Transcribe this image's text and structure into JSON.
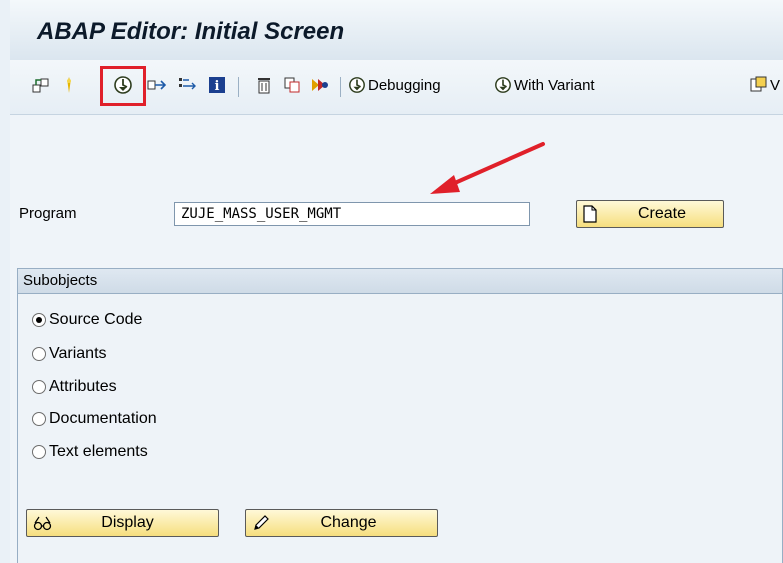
{
  "screen": {
    "title": "ABAP Editor: Initial Screen"
  },
  "toolbar": {
    "icons": [
      "other-object-icon",
      "activate-icon",
      "execute-icon",
      "where-used-icon",
      "display-object-list-icon",
      "info-icon",
      "delete-icon",
      "copy-icon",
      "rename-icon"
    ],
    "debugging_label": "Debugging",
    "with_variant_label": "With Variant",
    "truncated_label": "V"
  },
  "program": {
    "label": "Program",
    "value": "ZUJE_MASS_USER_MGMT"
  },
  "buttons": {
    "create": "Create",
    "display": "Display",
    "change": "Change"
  },
  "subobjects": {
    "title": "Subobjects",
    "options": [
      {
        "label": "Source Code",
        "selected": true
      },
      {
        "label": "Variants",
        "selected": false
      },
      {
        "label": "Attributes",
        "selected": false
      },
      {
        "label": "Documentation",
        "selected": false
      },
      {
        "label": "Text elements",
        "selected": false
      }
    ]
  },
  "annotation": {
    "highlight_color": "#e0202a",
    "arrow_color": "#e0202a"
  }
}
